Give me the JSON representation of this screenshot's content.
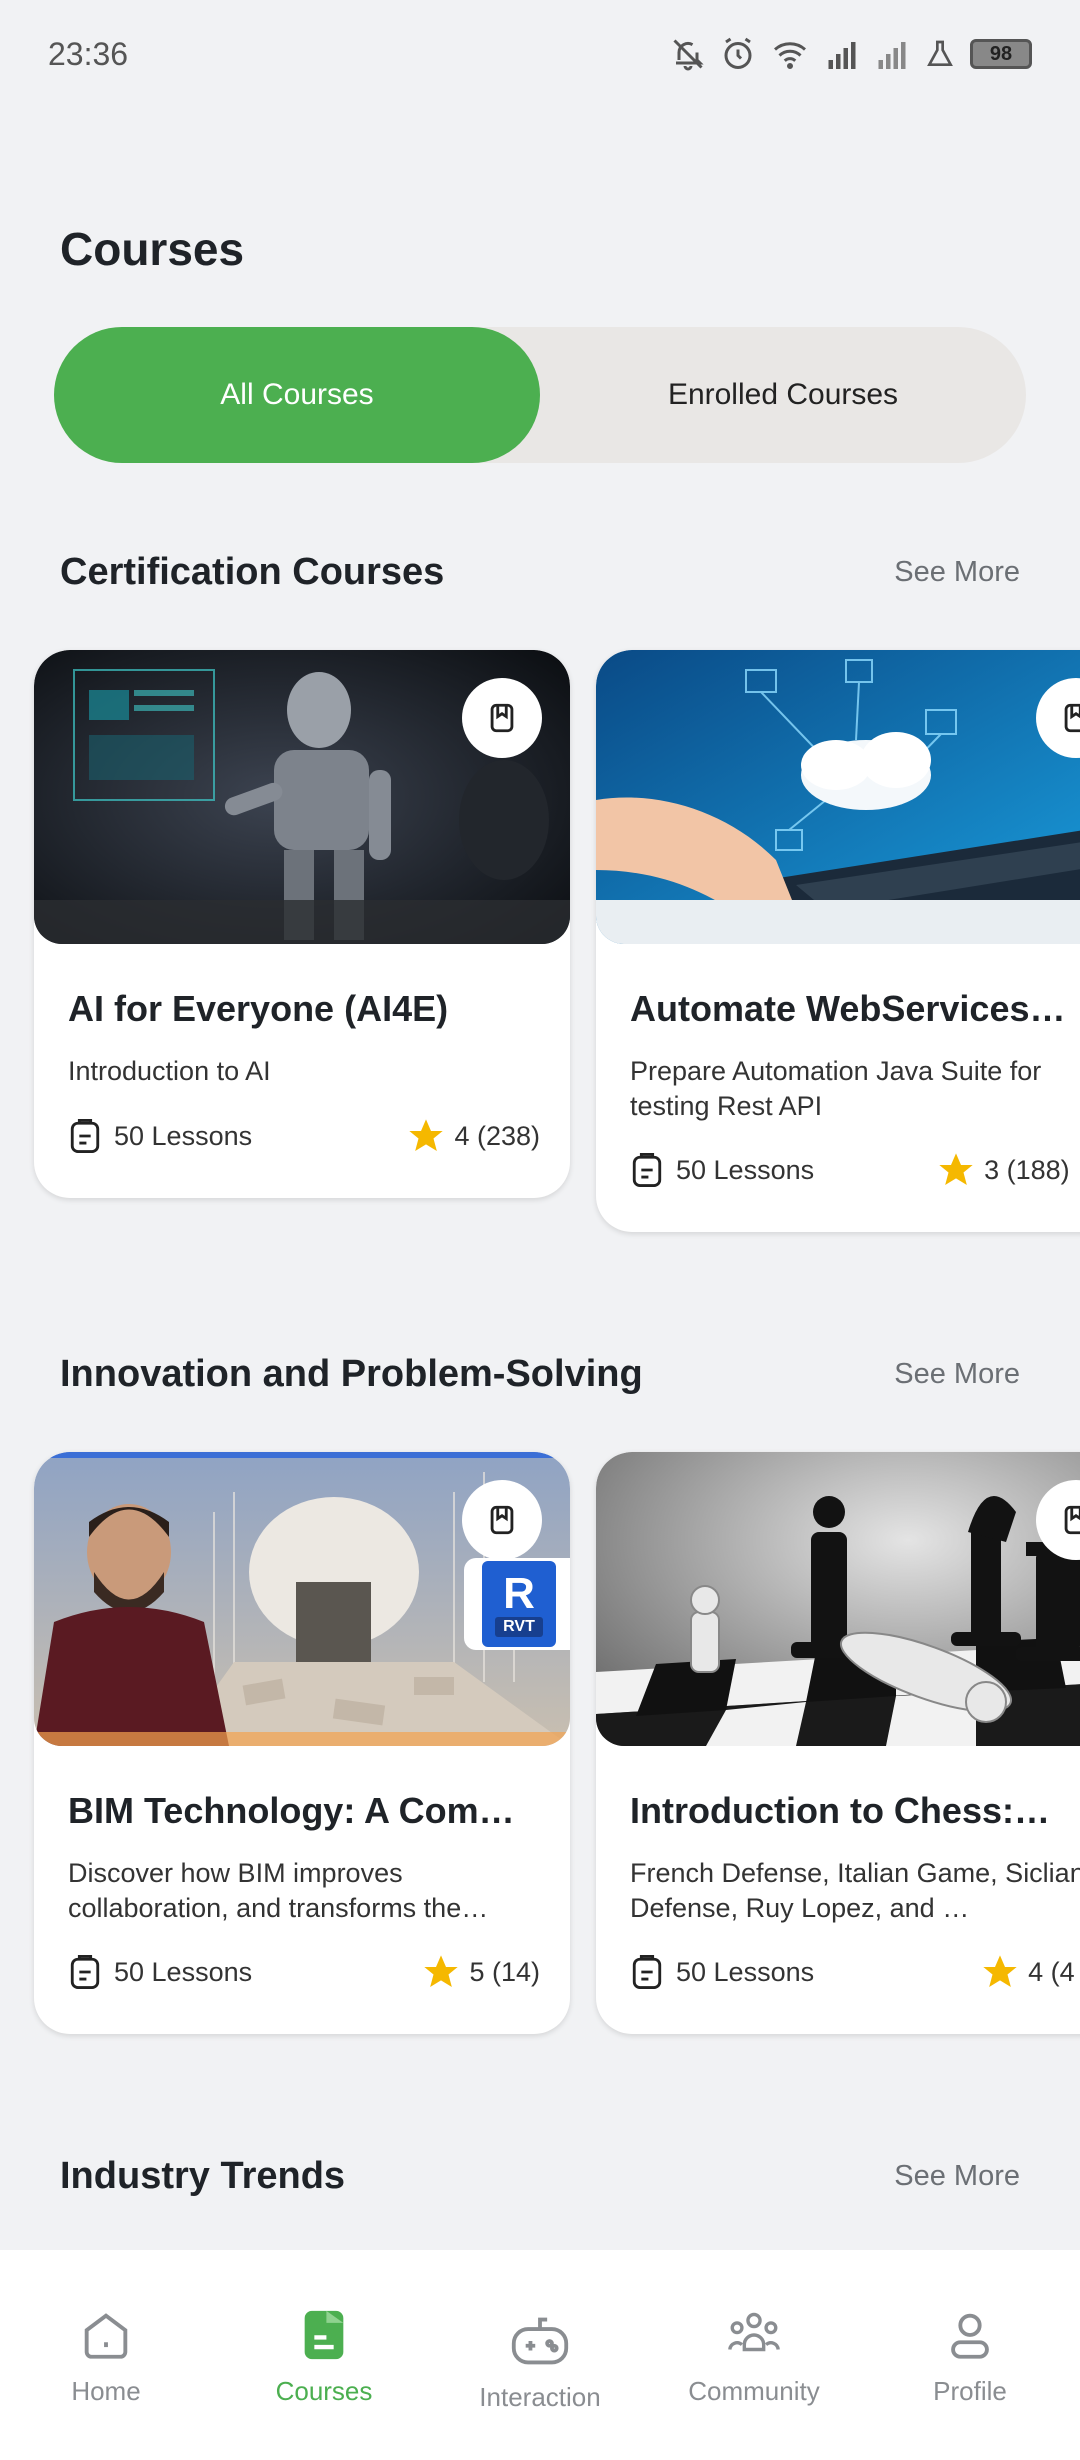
{
  "status_bar": {
    "time": "23:36",
    "battery": "98"
  },
  "page": {
    "title": "Courses"
  },
  "tabs": {
    "all": "All Courses",
    "enrolled": "Enrolled Courses"
  },
  "sections": [
    {
      "title": "Certification Courses",
      "see_more": "See More",
      "cards": [
        {
          "title": "AI for Everyone (AI4E)",
          "description": "Introduction to AI",
          "lessons": "50 Lessons",
          "rating": "4 (238)"
        },
        {
          "title": "Automate WebServices…",
          "description": "Prepare Automation Java Suite for testing Rest API",
          "lessons": "50 Lessons",
          "rating": "3 (188)"
        }
      ]
    },
    {
      "title": "Innovation and Problem-Solving",
      "see_more": "See More",
      "cards": [
        {
          "title": "BIM Technology: A Com…",
          "description": "Discover how BIM improves collaboration, and transforms the…",
          "lessons": "50 Lessons",
          "rating": "5 (14)",
          "badge": "RVT",
          "badge_letter": "R"
        },
        {
          "title": "Introduction to Chess:…",
          "description": "French Defense, Italian Game, Siclian Defense, Ruy Lopez, and …",
          "lessons": "50 Lessons",
          "rating": "4 (4"
        }
      ]
    },
    {
      "title": "Industry Trends",
      "see_more": "See More"
    }
  ],
  "nav": {
    "items": [
      {
        "label": "Home",
        "icon": "home-icon"
      },
      {
        "label": "Courses",
        "icon": "courses-icon",
        "active": true
      },
      {
        "label": "Interaction",
        "icon": "gamepad-icon"
      },
      {
        "label": "Community",
        "icon": "community-icon"
      },
      {
        "label": "Profile",
        "icon": "profile-icon"
      }
    ]
  },
  "colors": {
    "accent": "#4caf50",
    "star": "#f5b800",
    "background": "#f1f2f4"
  }
}
